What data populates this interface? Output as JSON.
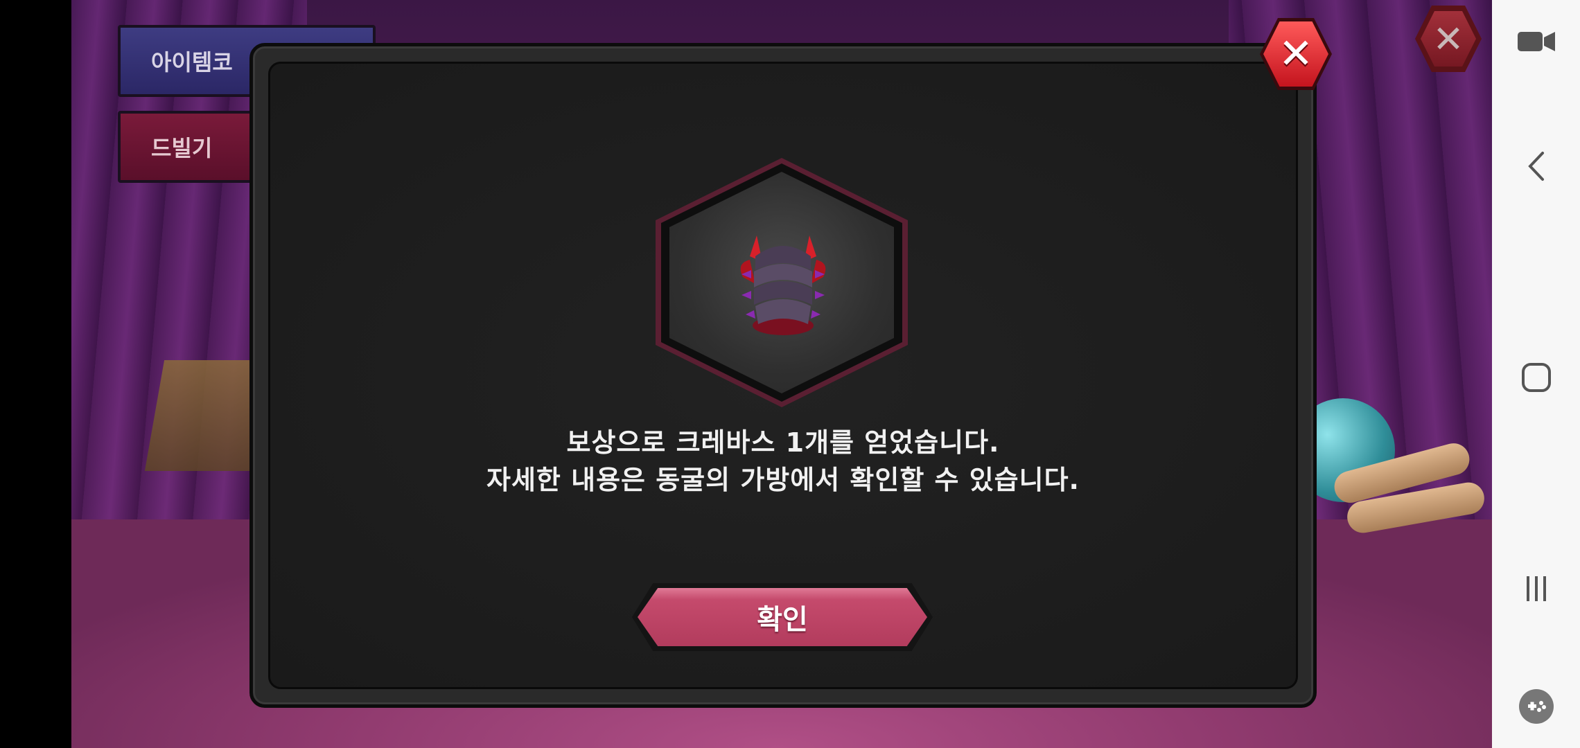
{
  "background": {
    "buttons": {
      "coupon_label": "아이템코",
      "drill_label": "드빌기"
    },
    "close_icon": "close-icon"
  },
  "modal": {
    "item_name_icon": "armor-item-icon",
    "message_line1": "보상으로 크레바스 1개를 얻었습니다.",
    "message_line2": "자세한 내용은 동굴의 가방에서 확인할 수 있습니다.",
    "confirm_label": "확인",
    "close_icon": "close-icon"
  },
  "android_nav": {
    "items": [
      "video-camera-icon",
      "back-icon",
      "home-icon",
      "recents-icon",
      "game-tools-icon"
    ]
  },
  "colors": {
    "accent_pink": "#c54a6c",
    "close_red": "#e0242e"
  }
}
